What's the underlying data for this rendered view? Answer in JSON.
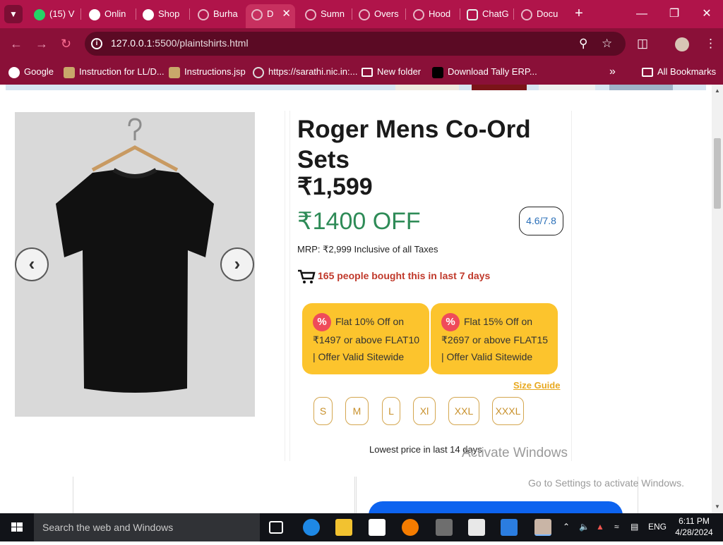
{
  "browser": {
    "tabs": [
      {
        "label": "(15) V",
        "icon": "whatsapp-icon"
      },
      {
        "label": "Onlin",
        "icon": "shield-icon"
      },
      {
        "label": "Shop",
        "icon": "shield-icon"
      },
      {
        "label": "Burha",
        "icon": "globe-icon"
      },
      {
        "label": "D",
        "icon": "globe-icon",
        "active": true
      },
      {
        "label": "Sumn",
        "icon": "globe-icon"
      },
      {
        "label": "Overs",
        "icon": "globe-icon"
      },
      {
        "label": "Hood",
        "icon": "globe-icon"
      },
      {
        "label": "ChatG",
        "icon": "chatgpt-icon"
      },
      {
        "label": "Docu",
        "icon": "globe-icon"
      }
    ],
    "url_host": "127.0.0.1",
    "url_path": ":5500/plaintshirts.html",
    "bookmarks": [
      {
        "label": "Google"
      },
      {
        "label": "Instruction for LL/D..."
      },
      {
        "label": "Instructions.jsp"
      },
      {
        "label": "https://sarathi.nic.in:..."
      },
      {
        "label": "New folder"
      },
      {
        "label": "Download Tally ERP..."
      }
    ],
    "all_bookmarks": "All Bookmarks",
    "accent_color": "#b0144a"
  },
  "product": {
    "title": "Roger Mens Co-Ord Sets",
    "price": "₹1,599",
    "discount": "₹1400 OFF",
    "rating": "4.6/7.8",
    "mrp": "MRP: ₹2,999 Inclusive of all Taxes",
    "bought": "165 people bought this in last 7 days",
    "offers": [
      {
        "line1": "Flat 10% Off on",
        "line2": "₹1497 or above FLAT10",
        "line3": "| Offer Valid Sitewide"
      },
      {
        "line1": "Flat 15% Off on",
        "line2": "₹2697 or above FLAT15",
        "line3": "| Offer Valid Sitewide"
      }
    ],
    "size_guide": "Size Guide",
    "sizes": [
      "S",
      "M",
      "L",
      "Xl",
      "XXL",
      "XXXL"
    ],
    "lowest_price": "Lowest price in last 14 days"
  },
  "watermark": {
    "title": "Activate Windows",
    "subtitle": "Go to Settings to activate Windows."
  },
  "taskbar": {
    "search_placeholder": "Search the web and Windows",
    "language": "ENG",
    "time": "6:11 PM",
    "date": "4/28/2024"
  }
}
